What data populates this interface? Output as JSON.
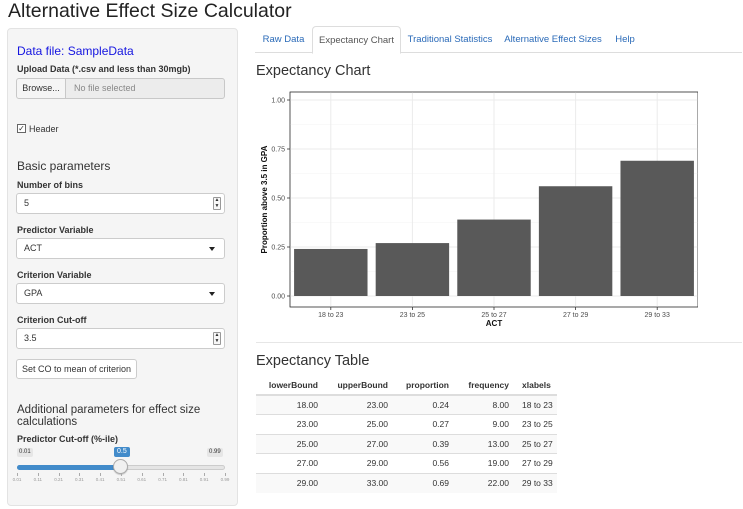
{
  "app": {
    "title": "Alternative Effect Size Calculator"
  },
  "sidebar": {
    "data_file_label": "Data file: SampleData",
    "upload_label": "Upload Data (*.csv and less than 30mgb)",
    "browse_label": "Browse...",
    "file_placeholder": "No file selected",
    "header_checkbox_label": "Header",
    "header_checked": true,
    "basic_heading": "Basic parameters",
    "bins_label": "Number of bins",
    "bins_value": "5",
    "predictor_label": "Predictor Variable",
    "predictor_value": "ACT",
    "criterion_label": "Criterion Variable",
    "criterion_value": "GPA",
    "cutoff_label": "Criterion Cut-off",
    "cutoff_value": "3.5",
    "setco_label": "Set CO to mean of criterion",
    "additional_heading": "Additional parameters for effect size calculations",
    "predictor_cutoff_label": "Predictor Cut-off (%-ile)",
    "slider": {
      "min_label": "0.01",
      "max_label": "0.99",
      "value_label": "0.5",
      "value": 0.5,
      "min": 0.01,
      "max": 0.99,
      "ticks": [
        "0.01",
        "0.11",
        "0.21",
        "0.31",
        "0.41",
        "0.51",
        "0.61",
        "0.71",
        "0.81",
        "0.91",
        "0.99"
      ]
    }
  },
  "tabs": [
    {
      "label": "Raw Data",
      "active": false
    },
    {
      "label": "Expectancy Chart",
      "active": true
    },
    {
      "label": "Traditional Statistics",
      "active": false
    },
    {
      "label": "Alternative Effect Sizes",
      "active": false
    },
    {
      "label": "Help",
      "active": false
    }
  ],
  "main": {
    "chart_heading": "Expectancy Chart",
    "table_heading": "Expectancy Table"
  },
  "chart_data": {
    "type": "bar",
    "categories": [
      "18 to 23",
      "23 to 25",
      "25 to 27",
      "27 to 29",
      "29 to 33"
    ],
    "values": [
      0.24,
      0.27,
      0.39,
      0.56,
      0.69
    ],
    "xlabel": "ACT",
    "ylabel": "Proportion above 3.5 in GPA",
    "ylim": [
      0,
      1
    ],
    "yticks": [
      "0.00",
      "0.25",
      "0.50",
      "0.75",
      "1.00"
    ],
    "grid": true,
    "bar_color": "#595959",
    "panel_background": "#ffffff",
    "gridline_color": "#ebebeb"
  },
  "table": {
    "columns": [
      "lowerBound",
      "upperBound",
      "proportion",
      "frequency",
      "xlabels"
    ],
    "rows": [
      [
        "18.00",
        "23.00",
        "0.24",
        "8.00",
        "18 to 23"
      ],
      [
        "23.00",
        "25.00",
        "0.27",
        "9.00",
        "23 to 25"
      ],
      [
        "25.00",
        "27.00",
        "0.39",
        "13.00",
        "25 to 27"
      ],
      [
        "27.00",
        "29.00",
        "0.56",
        "19.00",
        "27 to 29"
      ],
      [
        "29.00",
        "33.00",
        "0.69",
        "22.00",
        "29 to 33"
      ]
    ]
  },
  "colors": {
    "accent": "#428bca",
    "link": "#2a6ab8",
    "data_file": "#1515e0"
  }
}
